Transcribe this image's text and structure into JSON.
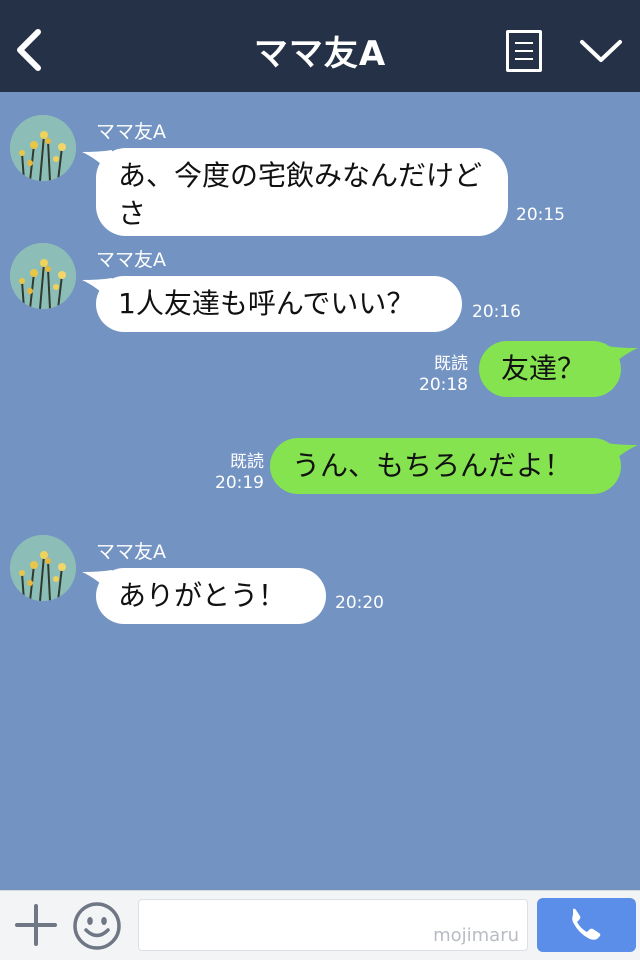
{
  "header": {
    "title": "ママ友A"
  },
  "contact": {
    "name": "ママ友A"
  },
  "messages": [
    {
      "dir": "in",
      "sender": "ママ友A",
      "text": "あ、今度の宅飲みなんだけどさ",
      "time": "20:15"
    },
    {
      "dir": "in",
      "sender": "ママ友A",
      "text": "1人友達も呼んでいい？",
      "time": "20:16"
    },
    {
      "dir": "out",
      "read": "既読",
      "text": "友達？",
      "time": "20:18"
    },
    {
      "dir": "out",
      "read": "既読",
      "text": "うん、もちろんだよ！",
      "time": "20:19"
    },
    {
      "dir": "in",
      "sender": "ママ友A",
      "text": "ありがとう！",
      "time": "20:20"
    }
  ],
  "input": {
    "watermark": "mojimaru",
    "value": ""
  },
  "colors": {
    "header": "#253147",
    "chat_bg": "#7393c2",
    "bubble_in": "#ffffff",
    "bubble_out": "#84e34f",
    "call_button": "#5a8ee8"
  },
  "icons": {
    "back": "chevron-left-icon",
    "menu": "document-icon",
    "collapse": "chevron-down-icon",
    "add": "plus-icon",
    "emoji": "smiley-icon",
    "call": "phone-icon"
  }
}
